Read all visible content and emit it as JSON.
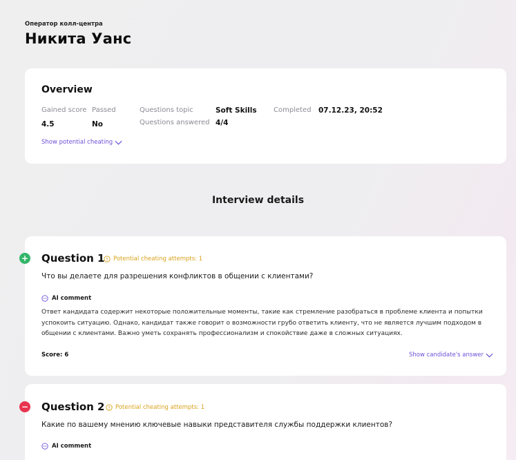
{
  "header": {
    "role": "Оператор колл-центра",
    "name": "Никита Уанс"
  },
  "overview": {
    "title": "Overview",
    "gained_score_label": "Gained score",
    "gained_score_value": "4.5",
    "passed_label": "Passed",
    "passed_value": "No",
    "questions_topic_label": "Questions topic",
    "questions_topic_value": "Soft Skills",
    "questions_answered_label": "Questions answered",
    "questions_answered_value": "4/4",
    "completed_label": "Completed",
    "completed_value": "07.12.23, 20:52",
    "show_cheating_link": "Show potential cheating"
  },
  "section_title": "Interview details",
  "questions": [
    {
      "title": "Question 1",
      "cheating": "Potential cheating attempts: 1",
      "text": "Что вы делаете для разрешения конфликтов в общении с клиентами?",
      "ai_label": "AI comment",
      "comment": "Ответ кандидата содержит некоторые положительные моменты, такие как стремление разобраться в проблеме клиента и попытки успокоить ситуацию. Однако, кандидат также говорит о возможности грубо ответить клиенту, что не является лучшим подходом в общении с клиентами. Важно уметь сохранять профессионализм и спокойствие даже в сложных ситуациях.",
      "score": "Score: 6",
      "show_answer": "Show candidate's answer",
      "marker": "+"
    },
    {
      "title": "Question 2",
      "cheating": "Potential cheating attempts: 1",
      "text": "Какие по вашему мнению ключевые навыки представителя службы поддержки клиентов?",
      "ai_label": "AI comment",
      "marker": "−"
    }
  ],
  "colors": {
    "accent": "#6b4fd8",
    "warning": "#d9a21b",
    "success": "#33b56a",
    "danger": "#e8344e"
  }
}
